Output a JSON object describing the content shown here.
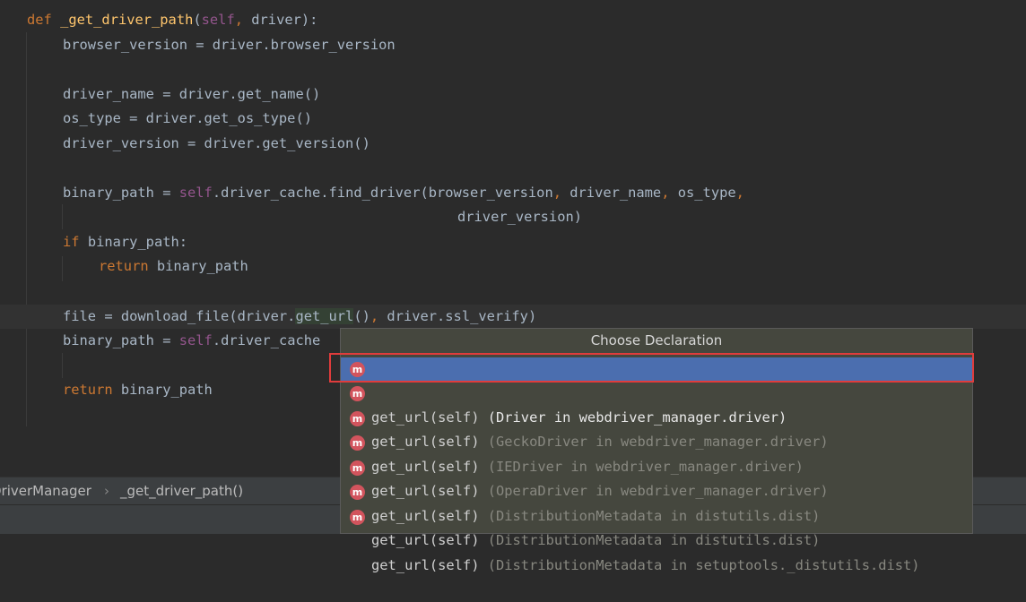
{
  "code": {
    "l1": {
      "def": "def",
      "name": "_get_driver_path",
      "open": "(",
      "self": "self",
      "comma": ",",
      "rest": " driver):"
    },
    "l2": {
      "text": "browser_version = driver.browser_version"
    },
    "l4": {
      "text": "driver_name = driver.get_name()"
    },
    "l5": {
      "text": "os_type = driver.get_os_type()"
    },
    "l6": {
      "text": "driver_version = driver.get_version()"
    },
    "l8": {
      "a": "binary_path = ",
      "self": "self",
      "b": ".driver_cache.find_driver(browser_version",
      "c1": ",",
      "d": " driver_name",
      "c2": ",",
      "e": " os_type",
      "c3": ","
    },
    "l9": {
      "text": "driver_version)"
    },
    "l10": {
      "kw": "if",
      "rest": " binary_path:"
    },
    "l11": {
      "kw": "return",
      "rest": " binary_path"
    },
    "l13": {
      "a": "file = download_file(driver.",
      "usage": "get_url",
      "b": "()",
      "c": ",",
      "d": " driver.ssl_verify)"
    },
    "l14": {
      "a": "binary_path = ",
      "self": "self",
      "b": ".driver_cache"
    },
    "l16": {
      "kw": "return",
      "rest": " binary_path"
    }
  },
  "breadcrumb": {
    "class_name": "DriverManager",
    "separator": "›",
    "method": "_get_driver_path()"
  },
  "popup": {
    "title": "Choose Declaration",
    "icon_letter": "m",
    "items": [
      {
        "sig": "get_url(self)",
        "cls": " (Driver in webdriver_manager.driver)"
      },
      {
        "sig": "get_url(self)",
        "cls": " (GeckoDriver in webdriver_manager.driver)"
      },
      {
        "sig": "get_url(self)",
        "cls": " (IEDriver in webdriver_manager.driver)"
      },
      {
        "sig": "get_url(self)",
        "cls": " (OperaDriver in webdriver_manager.driver)"
      },
      {
        "sig": "get_url(self)",
        "cls": " (DistributionMetadata in distutils.dist)"
      },
      {
        "sig": "get_url(self)",
        "cls": " (DistributionMetadata in distutils.dist)"
      },
      {
        "sig": "get_url(self)",
        "cls": " (DistributionMetadata in setuptools._distutils.dist)"
      }
    ]
  },
  "colors": {
    "editor_bg": "#2b2b2b",
    "keyword": "#cc7832",
    "self": "#94558d",
    "function_name": "#ffc66d",
    "selection": "#4b6eaf",
    "highlight_box": "#e03c3c"
  }
}
